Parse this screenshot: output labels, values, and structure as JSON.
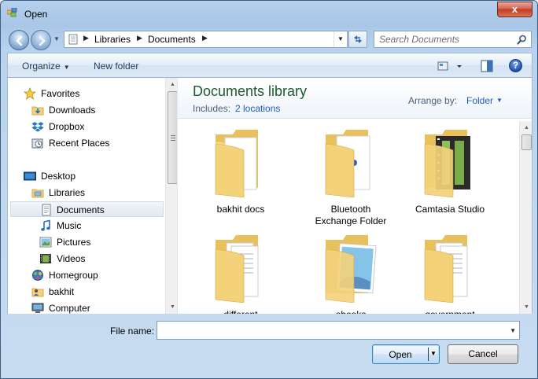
{
  "window": {
    "title": "Open",
    "close_glyph": "x"
  },
  "address": {
    "crumbs": [
      "Libraries",
      "Documents"
    ],
    "search_placeholder": "Search Documents"
  },
  "toolbar": {
    "organize": "Organize",
    "new_folder": "New folder",
    "help_glyph": "?"
  },
  "nav": {
    "items": [
      {
        "label": "Favorites",
        "icon": "star-icon"
      },
      {
        "label": "Downloads",
        "icon": "downloads-folder-icon"
      },
      {
        "label": "Dropbox",
        "icon": "dropbox-icon"
      },
      {
        "label": "Recent Places",
        "icon": "recent-places-icon"
      },
      {
        "label": "Desktop",
        "icon": "desktop-icon"
      },
      {
        "label": "Libraries",
        "icon": "libraries-icon"
      },
      {
        "label": "Documents",
        "icon": "documents-icon",
        "selected": true
      },
      {
        "label": "Music",
        "icon": "music-icon"
      },
      {
        "label": "Pictures",
        "icon": "pictures-icon"
      },
      {
        "label": "Videos",
        "icon": "videos-icon"
      },
      {
        "label": "Homegroup",
        "icon": "homegroup-icon"
      },
      {
        "label": "bakhit",
        "icon": "user-folder-icon"
      },
      {
        "label": "Computer",
        "icon": "computer-icon"
      }
    ]
  },
  "library": {
    "title": "Documents library",
    "includes_label": "Includes:",
    "locations": "2 locations",
    "arrange_label": "Arrange by:",
    "arrange_value": "Folder"
  },
  "files": [
    {
      "label_1": "bakhit docs",
      "label_2": "",
      "icon": "folder-icon"
    },
    {
      "label_1": "Bluetooth",
      "label_2": "Exchange Folder",
      "icon": "bluetooth-folder-icon"
    },
    {
      "label_1": "Camtasia Studio",
      "label_2": "",
      "icon": "video-folder-icon"
    },
    {
      "label_1": "different",
      "label_2": "",
      "icon": "documents-folder-icon"
    },
    {
      "label_1": "ebooks",
      "label_2": "",
      "icon": "picture-folder-icon"
    },
    {
      "label_1": "government",
      "label_2": "",
      "icon": "documents-folder-icon"
    }
  ],
  "bottom": {
    "filename_label": "File name:",
    "filename_value": "",
    "open_label": "Open",
    "cancel_label": "Cancel"
  },
  "colors": {
    "accent_link": "#1e5fb8",
    "library_title": "#1e5a2d",
    "folder": "#f3d27a"
  }
}
